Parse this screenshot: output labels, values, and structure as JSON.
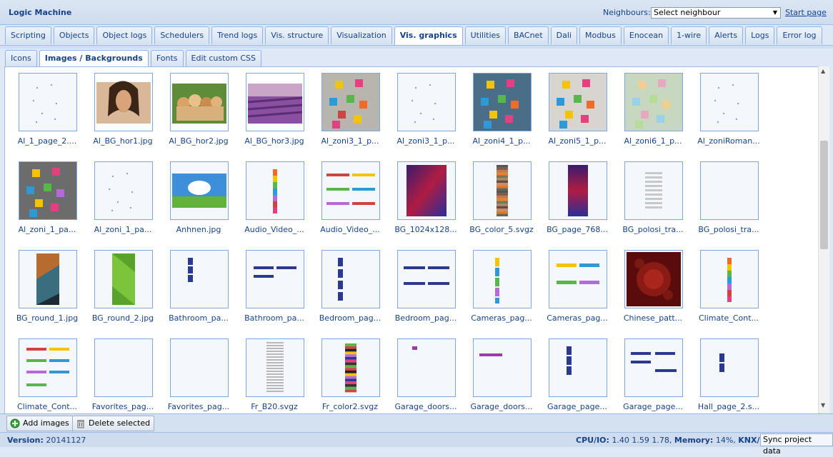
{
  "header": {
    "title": "Logic Machine",
    "neighbours_label": "Neighbours:",
    "neighbour_select_value": "Select neighbour",
    "start_page": "Start page"
  },
  "tabs": [
    "Scripting",
    "Objects",
    "Object logs",
    "Schedulers",
    "Trend logs",
    "Vis. structure",
    "Visualization",
    "Vis. graphics",
    "Utilities",
    "BACnet",
    "Dali",
    "Modbus",
    "Enocean",
    "1-wire",
    "Alerts",
    "Logs",
    "Error log"
  ],
  "active_tab": "Vis. graphics",
  "subtabs": [
    "Icons",
    "Images / Backgrounds",
    "Fonts",
    "Edit custom CSS"
  ],
  "active_subtab": "Images / Backgrounds",
  "images": [
    {
      "name": "Al_1_page_2....",
      "kind": "dots"
    },
    {
      "name": "Al_BG_hor1.jpg",
      "kind": "portrait"
    },
    {
      "name": "Al_BG_hor2.jpg",
      "kind": "kittens"
    },
    {
      "name": "Al_BG_hor3.jpg",
      "kind": "lavender"
    },
    {
      "name": "Al_zoni3_1_p...",
      "kind": "notes-grey"
    },
    {
      "name": "Al_zoni3_1_p...",
      "kind": "dots"
    },
    {
      "name": "Al_zoni4_1_p...",
      "kind": "notes-graffiti"
    },
    {
      "name": "Al_zoni5_1_p...",
      "kind": "notes-light"
    },
    {
      "name": "Al_zoni6_1_p...",
      "kind": "notes-pastel"
    },
    {
      "name": "Al_zoniRoman...",
      "kind": "dots"
    },
    {
      "name": "Al_zoni_1_pa...",
      "kind": "notes-room"
    },
    {
      "name": "Al_zoni_1_pa...",
      "kind": "dots"
    },
    {
      "name": "Anhnen.jpg",
      "kind": "landscape"
    },
    {
      "name": "Audio_Video_...",
      "kind": "vstrip-color"
    },
    {
      "name": "Audio_Video_...",
      "kind": "hbars-color"
    },
    {
      "name": "BG_1024x128...",
      "kind": "purple-gradient"
    },
    {
      "name": "BG_color_5.svgz",
      "kind": "stripes-brown"
    },
    {
      "name": "BG_page_768...",
      "kind": "purple-narrow"
    },
    {
      "name": "BG_polosi_tra...",
      "kind": "grey-lines"
    },
    {
      "name": "BG_polosi_tra...",
      "kind": "blank"
    },
    {
      "name": "BG_round_1.jpg",
      "kind": "diamond-dark"
    },
    {
      "name": "BG_round_2.jpg",
      "kind": "green-diag"
    },
    {
      "name": "Bathroom_pa...",
      "kind": "vbars-blue-small"
    },
    {
      "name": "Bathroom_pa...",
      "kind": "hbars-blue"
    },
    {
      "name": "Bedroom_pag...",
      "kind": "vbars-blue"
    },
    {
      "name": "Bedroom_pag...",
      "kind": "hbars-blue-wide"
    },
    {
      "name": "Cameras_pag...",
      "kind": "vstrip-cameras"
    },
    {
      "name": "Cameras_pag...",
      "kind": "hbars-cameras"
    },
    {
      "name": "Chinese_patt...",
      "kind": "chinese"
    },
    {
      "name": "Climate_Cont...",
      "kind": "vstrip-color"
    },
    {
      "name": "Climate_Cont...",
      "kind": "hbars-climate"
    },
    {
      "name": "Favorites_pag...",
      "kind": "blank"
    },
    {
      "name": "Favorites_pag...",
      "kind": "blank"
    },
    {
      "name": "Fr_B20.svgz",
      "kind": "grey-lines-tall"
    },
    {
      "name": "Fr_color2.svgz",
      "kind": "stripes-multi"
    },
    {
      "name": "Garage_doors...",
      "kind": "purple-dot"
    },
    {
      "name": "Garage_doors...",
      "kind": "purple-bar"
    },
    {
      "name": "Garage_page...",
      "kind": "vbars-blue-tall"
    },
    {
      "name": "Garage_page...",
      "kind": "hbars-blue-garage"
    },
    {
      "name": "Hall_page_2.s...",
      "kind": "vbars-blue-hall"
    }
  ],
  "toolbar": {
    "add_images": "Add images",
    "delete_selected": "Delete selected"
  },
  "status": {
    "version_label": "Version:",
    "version_value": "20141127",
    "cpu_label": "CPU/IO:",
    "cpu_value": "1.40 1.59 1.78,",
    "memory_label": "Memory:",
    "memory_value": "14%,",
    "knx_label": "KNX/IP",
    "sync_button": "Sync project data"
  }
}
